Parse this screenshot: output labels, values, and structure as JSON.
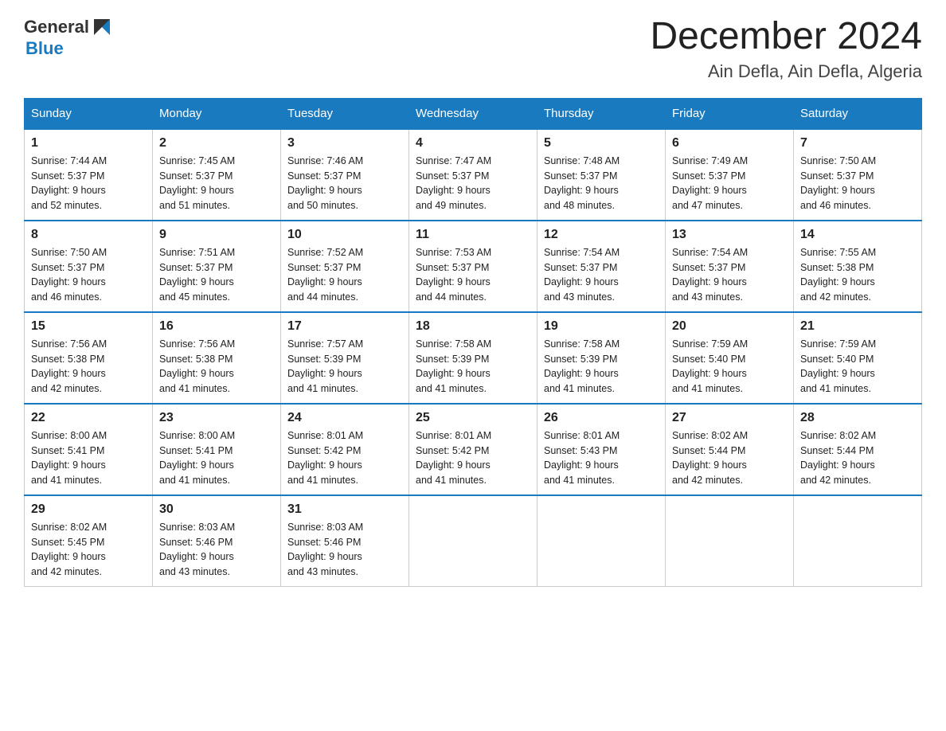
{
  "header": {
    "logo_general": "General",
    "logo_blue": "Blue",
    "title": "December 2024",
    "subtitle": "Ain Defla, Ain Defla, Algeria"
  },
  "days_of_week": [
    "Sunday",
    "Monday",
    "Tuesday",
    "Wednesday",
    "Thursday",
    "Friday",
    "Saturday"
  ],
  "weeks": [
    [
      {
        "day": "1",
        "sunrise": "7:44 AM",
        "sunset": "5:37 PM",
        "daylight": "9 hours and 52 minutes."
      },
      {
        "day": "2",
        "sunrise": "7:45 AM",
        "sunset": "5:37 PM",
        "daylight": "9 hours and 51 minutes."
      },
      {
        "day": "3",
        "sunrise": "7:46 AM",
        "sunset": "5:37 PM",
        "daylight": "9 hours and 50 minutes."
      },
      {
        "day": "4",
        "sunrise": "7:47 AM",
        "sunset": "5:37 PM",
        "daylight": "9 hours and 49 minutes."
      },
      {
        "day": "5",
        "sunrise": "7:48 AM",
        "sunset": "5:37 PM",
        "daylight": "9 hours and 48 minutes."
      },
      {
        "day": "6",
        "sunrise": "7:49 AM",
        "sunset": "5:37 PM",
        "daylight": "9 hours and 47 minutes."
      },
      {
        "day": "7",
        "sunrise": "7:50 AM",
        "sunset": "5:37 PM",
        "daylight": "9 hours and 46 minutes."
      }
    ],
    [
      {
        "day": "8",
        "sunrise": "7:50 AM",
        "sunset": "5:37 PM",
        "daylight": "9 hours and 46 minutes."
      },
      {
        "day": "9",
        "sunrise": "7:51 AM",
        "sunset": "5:37 PM",
        "daylight": "9 hours and 45 minutes."
      },
      {
        "day": "10",
        "sunrise": "7:52 AM",
        "sunset": "5:37 PM",
        "daylight": "9 hours and 44 minutes."
      },
      {
        "day": "11",
        "sunrise": "7:53 AM",
        "sunset": "5:37 PM",
        "daylight": "9 hours and 44 minutes."
      },
      {
        "day": "12",
        "sunrise": "7:54 AM",
        "sunset": "5:37 PM",
        "daylight": "9 hours and 43 minutes."
      },
      {
        "day": "13",
        "sunrise": "7:54 AM",
        "sunset": "5:37 PM",
        "daylight": "9 hours and 43 minutes."
      },
      {
        "day": "14",
        "sunrise": "7:55 AM",
        "sunset": "5:38 PM",
        "daylight": "9 hours and 42 minutes."
      }
    ],
    [
      {
        "day": "15",
        "sunrise": "7:56 AM",
        "sunset": "5:38 PM",
        "daylight": "9 hours and 42 minutes."
      },
      {
        "day": "16",
        "sunrise": "7:56 AM",
        "sunset": "5:38 PM",
        "daylight": "9 hours and 41 minutes."
      },
      {
        "day": "17",
        "sunrise": "7:57 AM",
        "sunset": "5:39 PM",
        "daylight": "9 hours and 41 minutes."
      },
      {
        "day": "18",
        "sunrise": "7:58 AM",
        "sunset": "5:39 PM",
        "daylight": "9 hours and 41 minutes."
      },
      {
        "day": "19",
        "sunrise": "7:58 AM",
        "sunset": "5:39 PM",
        "daylight": "9 hours and 41 minutes."
      },
      {
        "day": "20",
        "sunrise": "7:59 AM",
        "sunset": "5:40 PM",
        "daylight": "9 hours and 41 minutes."
      },
      {
        "day": "21",
        "sunrise": "7:59 AM",
        "sunset": "5:40 PM",
        "daylight": "9 hours and 41 minutes."
      }
    ],
    [
      {
        "day": "22",
        "sunrise": "8:00 AM",
        "sunset": "5:41 PM",
        "daylight": "9 hours and 41 minutes."
      },
      {
        "day": "23",
        "sunrise": "8:00 AM",
        "sunset": "5:41 PM",
        "daylight": "9 hours and 41 minutes."
      },
      {
        "day": "24",
        "sunrise": "8:01 AM",
        "sunset": "5:42 PM",
        "daylight": "9 hours and 41 minutes."
      },
      {
        "day": "25",
        "sunrise": "8:01 AM",
        "sunset": "5:42 PM",
        "daylight": "9 hours and 41 minutes."
      },
      {
        "day": "26",
        "sunrise": "8:01 AM",
        "sunset": "5:43 PM",
        "daylight": "9 hours and 41 minutes."
      },
      {
        "day": "27",
        "sunrise": "8:02 AM",
        "sunset": "5:44 PM",
        "daylight": "9 hours and 42 minutes."
      },
      {
        "day": "28",
        "sunrise": "8:02 AM",
        "sunset": "5:44 PM",
        "daylight": "9 hours and 42 minutes."
      }
    ],
    [
      {
        "day": "29",
        "sunrise": "8:02 AM",
        "sunset": "5:45 PM",
        "daylight": "9 hours and 42 minutes."
      },
      {
        "day": "30",
        "sunrise": "8:03 AM",
        "sunset": "5:46 PM",
        "daylight": "9 hours and 43 minutes."
      },
      {
        "day": "31",
        "sunrise": "8:03 AM",
        "sunset": "5:46 PM",
        "daylight": "9 hours and 43 minutes."
      },
      null,
      null,
      null,
      null
    ]
  ],
  "labels": {
    "sunrise": "Sunrise:",
    "sunset": "Sunset:",
    "daylight": "Daylight:"
  }
}
